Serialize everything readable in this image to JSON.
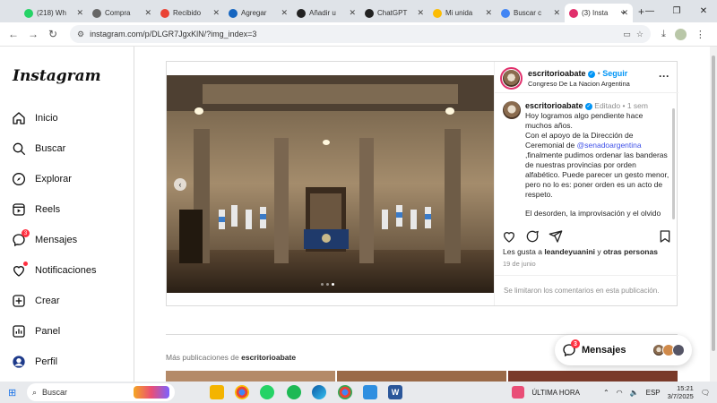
{
  "browser": {
    "tabs": [
      {
        "title": "(218) Wh",
        "icon": "whatsapp-icon",
        "color": "#25d366"
      },
      {
        "title": "Compra",
        "icon": "globe-icon",
        "color": "#666666"
      },
      {
        "title": "Recibido",
        "icon": "gmail-icon",
        "color": "#ea4335"
      },
      {
        "title": "Agregar",
        "icon": "bookmark-icon",
        "color": "#1565c0"
      },
      {
        "title": "Añadir u",
        "icon": "threads-icon",
        "color": "#222222"
      },
      {
        "title": "ChatGPT",
        "icon": "chatgpt-icon",
        "color": "#222222"
      },
      {
        "title": "Mi unida",
        "icon": "drive-icon",
        "color": "#fbbc04"
      },
      {
        "title": "Buscar c",
        "icon": "google-icon",
        "color": "#4285f4"
      },
      {
        "title": "(3) Insta",
        "icon": "instagram-icon",
        "color": "#e1306c"
      }
    ],
    "new_tab": "+",
    "url": "instagram.com/p/DLGR7JgxKlN/?img_index=3"
  },
  "sidebar": {
    "logo": "Instagram",
    "items": [
      {
        "label": "Inicio",
        "icon": "home-icon"
      },
      {
        "label": "Buscar",
        "icon": "search-icon"
      },
      {
        "label": "Explorar",
        "icon": "compass-icon"
      },
      {
        "label": "Reels",
        "icon": "reels-icon"
      },
      {
        "label": "Mensajes",
        "icon": "messenger-icon",
        "badge": "3"
      },
      {
        "label": "Notificaciones",
        "icon": "heart-icon"
      },
      {
        "label": "Crear",
        "icon": "plus-square-icon"
      },
      {
        "label": "Panel",
        "icon": "chart-icon"
      },
      {
        "label": "Perfil",
        "icon": "profile-icon"
      }
    ]
  },
  "post": {
    "username": "escritorioabate",
    "follow": "Seguir",
    "location": "Congreso De La Nacion Argentina",
    "edited": "Editado",
    "age": "1 sem",
    "caption": {
      "line1": "Hoy logramos algo pendiente hace muchos años.",
      "line2a": "Con el  apoyo de la Dirección de Ceremonial de ",
      "mention": "@senadoargentina",
      "line2b": " ,finalmente pudimos ordenar las banderas de nuestras provincias por orden alfabético. Puede parecer un gesto menor, pero no lo es: poner orden es un acto de respeto.",
      "line3": "El desorden, la improvisación y el olvido"
    },
    "likes_prefix": "Les gusta a ",
    "likes_user": "leandeyuanini",
    "likes_mid": " y ",
    "likes_others": "otras personas",
    "date": "19 de junio",
    "comments_off": "Se limitaron los comentarios en esta publicación."
  },
  "more_posts": {
    "prefix": "Más publicaciones de ",
    "user": "escritorioabate"
  },
  "messages_pill": {
    "label": "Mensajes",
    "badge": "3"
  },
  "taskbar": {
    "search": "Buscar",
    "weather": "ÚLTIMA HORA",
    "lang": "ESP",
    "time": "15:21",
    "date": "3/7/2025"
  }
}
